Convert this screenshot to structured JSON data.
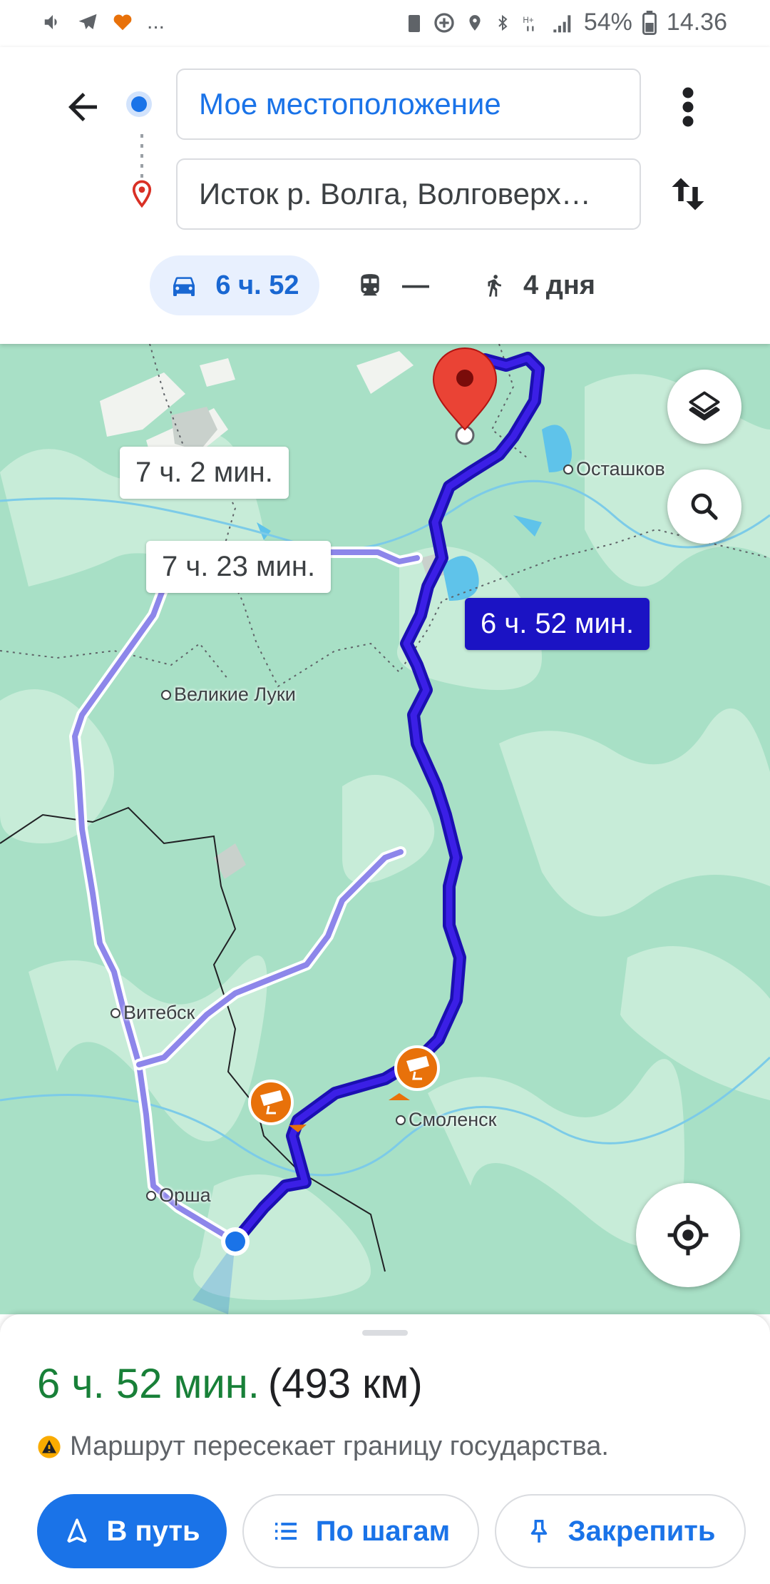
{
  "status_bar": {
    "left_icons": [
      "volume-icon",
      "telegram-icon",
      "health-icon",
      "more-notifications-icon"
    ],
    "more": "...",
    "battery_percent": "54%",
    "time": "14.36"
  },
  "directions": {
    "origin": "Мое местоположение",
    "destination": "Исток р. Волга, Волговерх…",
    "modes": {
      "car": "6 ч. 52",
      "transit": "—",
      "walk": "4 дня"
    }
  },
  "map": {
    "route_labels": {
      "main": "6 ч. 52 мин.",
      "alt1": "7 ч. 2 мин.",
      "alt2": "7 ч. 23 мин."
    },
    "cities": {
      "ostashkov": "Осташков",
      "velikie_luki": "Великие Луки",
      "vitebsk": "Витебск",
      "smolensk": "Смоленск",
      "orsha": "Орша"
    },
    "colors": {
      "route_main": "#2a0fd6",
      "route_alt": "#8d86ea",
      "map_base": "#a8e0c6",
      "speed_camera": "#e8710a"
    }
  },
  "sheet": {
    "duration": "6 ч. 52 мин.",
    "distance": "(493 км)",
    "warning": "Маршрут пересекает границу государства.",
    "buttons": {
      "start": "В путь",
      "steps": "По шагам",
      "pin": "Закрепить"
    }
  }
}
